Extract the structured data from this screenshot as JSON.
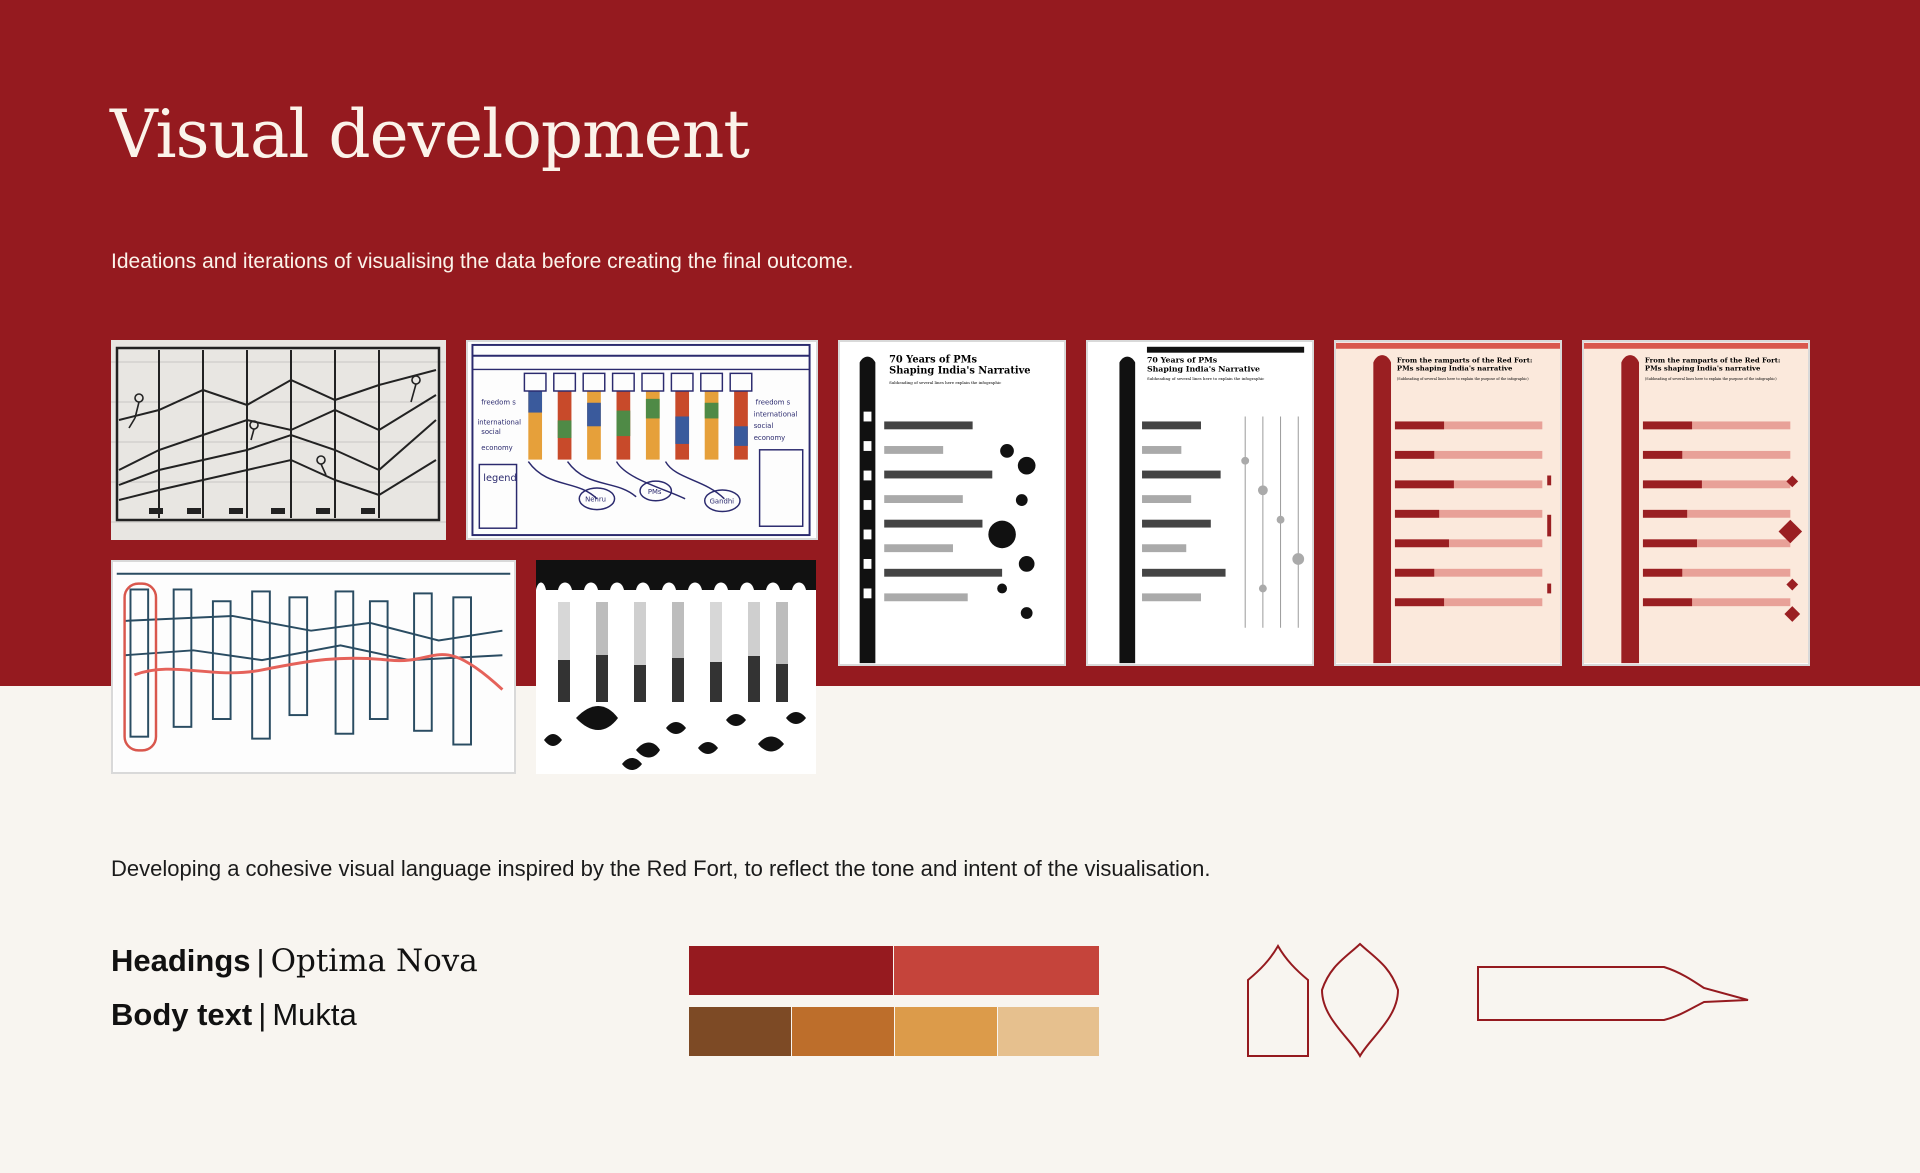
{
  "header": {
    "title": "Visual development",
    "subtitle": "Ideations and iterations of visualising the data before creating the final outcome."
  },
  "sketches": {
    "sketch2_labels": {
      "freedom": "freedom s",
      "international": "international",
      "social": "social",
      "economy": "economy",
      "legend": "legend",
      "nehru": "Nehru",
      "pms": "PMs",
      "gandhi": "Gandhi"
    }
  },
  "iterations": [
    {
      "title_line1": "70 Years of PMs",
      "title_line2": "Shaping India's Narrative",
      "subheading": "Subheading of several lines here explain the infographic"
    },
    {
      "title_line1": "70 Years of PMs",
      "title_line2": "Shaping India's Narrative",
      "subheading": "Subheading of several lines here to explain the infographic"
    },
    {
      "title_line1": "From the ramparts of the Red Fort:",
      "title_line2": "PMs shaping India's narrative",
      "subheading": "(Subheading of several lines here to explain the purpose of the infographic)"
    },
    {
      "title_line1": "From the ramparts of the Red Fort:",
      "title_line2": "PMs shaping India's narrative",
      "subheading": "(Subheading of several lines here to explain the purpose of the infographic)"
    }
  ],
  "language": {
    "statement": "Developing a cohesive visual language inspired by the Red Fort, to reflect the tone and intent of the visualisation.",
    "headings_label": "Headings",
    "headings_font": "Optima Nova",
    "body_label": "Body text",
    "body_font": "Mukta",
    "separator": "|"
  },
  "palette": {
    "primary": [
      "#961a1f",
      "#c5443b"
    ],
    "secondary": [
      "#7d4a25",
      "#bd6e2b",
      "#dc9b4a",
      "#e6c08e"
    ]
  },
  "motifs": [
    "arch-window-icon",
    "lotus-dome-icon",
    "pennant-flag-icon"
  ]
}
